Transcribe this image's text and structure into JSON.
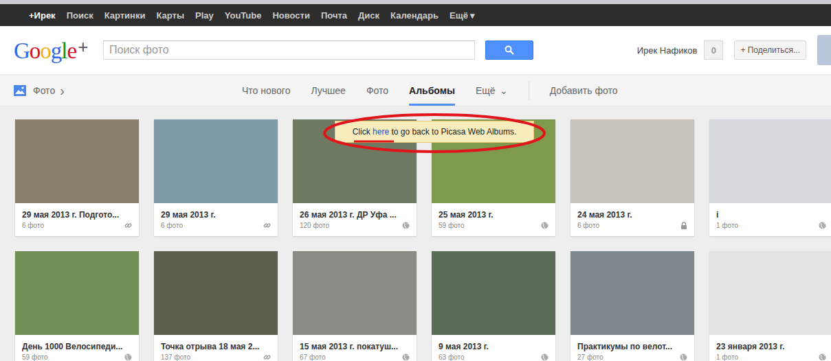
{
  "topbar": {
    "items": [
      {
        "label": "+Ирек",
        "selected": true
      },
      {
        "label": "Поиск",
        "selected": false
      },
      {
        "label": "Картинки",
        "selected": false
      },
      {
        "label": "Карты",
        "selected": false
      },
      {
        "label": "Play",
        "selected": false
      },
      {
        "label": "YouTube",
        "selected": false
      },
      {
        "label": "Новости",
        "selected": false
      },
      {
        "label": "Почта",
        "selected": false
      },
      {
        "label": "Диск",
        "selected": false
      },
      {
        "label": "Календарь",
        "selected": false
      },
      {
        "label": "Ещё ▾",
        "selected": false
      }
    ]
  },
  "header": {
    "logo": "Google",
    "logo_plus": "+",
    "search": {
      "placeholder": "Поиск фото"
    },
    "user": "Ирек Нафиков",
    "notifications": "0",
    "share_button": "+ Поделиться..."
  },
  "nav": {
    "section": "Фото",
    "section_arrow": "›",
    "tabs": [
      {
        "label": "Что нового",
        "selected": false
      },
      {
        "label": "Лучшее",
        "selected": false
      },
      {
        "label": "Фото",
        "selected": false
      },
      {
        "label": "Альбомы",
        "selected": true
      },
      {
        "label": "Ещё",
        "selected": false
      }
    ],
    "more_arrow": "⌄",
    "add_button": "Добавить фото"
  },
  "tooltip": {
    "before": "Click ",
    "link": "here",
    "after": " to go back to Picasa Web Albums.",
    "highlighted": true
  },
  "albums": [
    {
      "title": "29 мая 2013 г. Подгото...",
      "count": "6 фото",
      "access": "link",
      "has_cover": true
    },
    {
      "title": "29 мая 2013 г.",
      "count": "6 фото",
      "access": "link",
      "has_cover": true
    },
    {
      "title": "26 мая 2013 г. ДР Уфа ...",
      "count": "120 фото",
      "access": "public",
      "has_cover": true
    },
    {
      "title": "25 мая 2013 г.",
      "count": "59 фото",
      "access": "public",
      "has_cover": true
    },
    {
      "title": "24 мая 2013 г.",
      "count": "6 фото",
      "access": "private",
      "has_cover": true
    },
    {
      "title": "i",
      "count": "1 фото",
      "access": "public",
      "has_cover": true
    },
    {
      "title": "День 1000 Велосипеди...",
      "count": "59 фото",
      "access": "public",
      "has_cover": true
    },
    {
      "title": "Точка отрыва 18 мая 2...",
      "count": "137 фото",
      "access": "link",
      "has_cover": true
    },
    {
      "title": "15 мая 2013 г. покатуш...",
      "count": "67 фото",
      "access": "public",
      "has_cover": true
    },
    {
      "title": "9 мая 2013 г.",
      "count": "63 фото",
      "access": "public",
      "has_cover": true
    },
    {
      "title": "Практикумы по велот...",
      "count": "27 фото",
      "access": "public",
      "has_cover": true
    },
    {
      "title": "23 января 2013 г.",
      "count": "1 фото",
      "access": "public",
      "has_cover": false
    }
  ]
}
